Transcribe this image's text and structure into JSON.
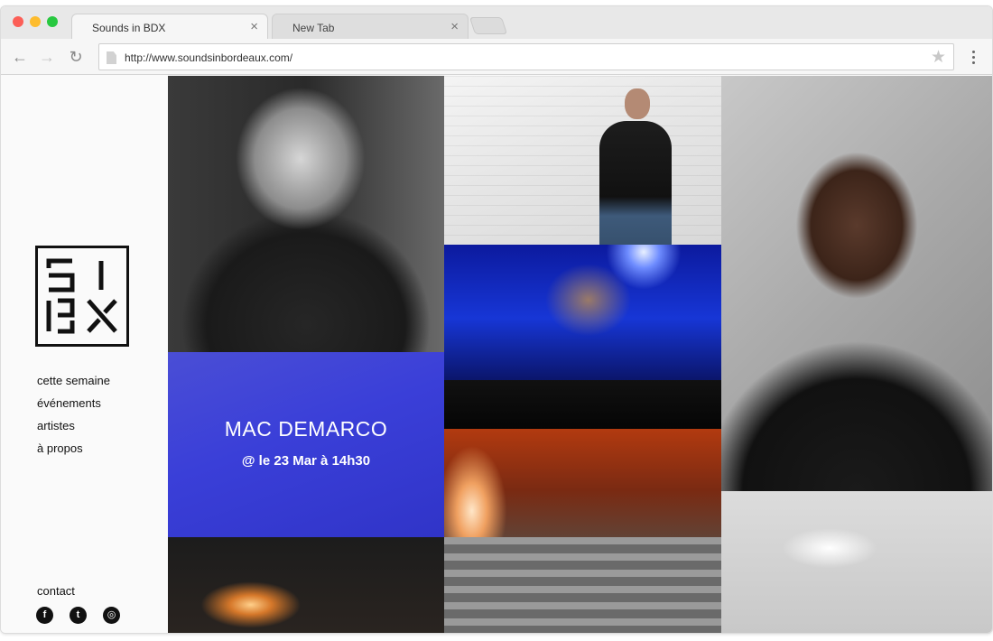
{
  "browser": {
    "tabs": [
      {
        "title": "Sounds in BDX",
        "active": true
      },
      {
        "title": "New Tab",
        "active": false
      }
    ],
    "tab_close_glyph": "×",
    "url": "http://www.soundsinbordeaux.com/",
    "icons": {
      "back": "arrow-left-icon",
      "forward": "arrow-right-icon",
      "reload": "reload-icon",
      "bookmark": "star-icon",
      "menu": "kebab-menu-icon"
    },
    "traffic_lights": {
      "close": "#fc5f57",
      "minimize": "#fdbc2e",
      "maximize": "#28c840"
    }
  },
  "sidebar": {
    "logo_text": "S I BX",
    "nav": [
      {
        "label": "cette semaine"
      },
      {
        "label": "événements"
      },
      {
        "label": "artistes"
      },
      {
        "label": "à propos"
      }
    ],
    "contact_label": "contact",
    "social": [
      {
        "icon": "facebook-icon",
        "glyph": "f"
      },
      {
        "icon": "twitter-icon",
        "glyph": "t"
      },
      {
        "icon": "instagram-icon",
        "glyph": "◎"
      }
    ]
  },
  "featured_event": {
    "artist": "MAC DEMARCO",
    "date_line": "@ le 23 Mar à 14h30",
    "overlay_color": "#3a3fd8"
  }
}
